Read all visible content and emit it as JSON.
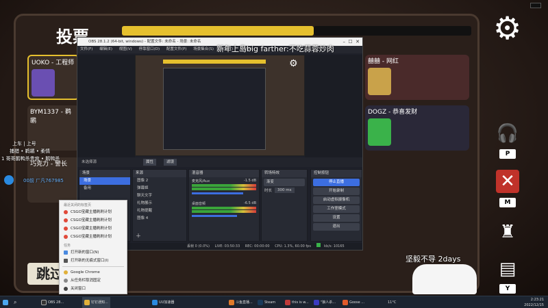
{
  "game": {
    "vote_title": "投票",
    "skip_label": "跳过",
    "players": [
      {
        "name": "UOKO - 工程师"
      },
      {
        "name": "BYM1337 - 鹈鹕"
      },
      {
        "name": "巧克力 - 警长"
      },
      {
        "name": "囍囍 - 网红"
      },
      {
        "name": "DOGZ - 恭喜发财"
      }
    ],
    "side_keys": [
      "P",
      "M",
      "Y"
    ],
    "left_messages": [
      "上车 | 上号",
      "捕猎 • 鹈鹕 • 柔情",
      "1 哥哥鹅鸭杀贵宾 • 鹅鸭杀",
      "00前 ㄏ凡767985"
    ],
    "streamer_tag": "坚毅不导 2days"
  },
  "chat_overlay": {
    "title": "新年上岛big farther:不吃蒜蓉炒肉"
  },
  "obs": {
    "window_title": "OBS 28.1.2 (64-bit, windows) - 配置文件: 未命名 - 场景: 未命名",
    "menu": [
      "文件(F)",
      "编辑(E)",
      "视图(V)",
      "停靠窗口(D)",
      "配置文件(P)",
      "场景集合(S)",
      "工具(T)",
      "帮助(H)"
    ],
    "source_bar": {
      "label": "未选择源",
      "props": "属性",
      "filters": "滤镜"
    },
    "scenes": {
      "title": "场景",
      "items": [
        "场景",
        "备用"
      ]
    },
    "sources": {
      "title": "来源",
      "items": [
        "图像 2",
        "弹幕姬",
        "聊天文字",
        "礼物展示",
        "礼物提醒",
        "图像 4"
      ]
    },
    "mixer": {
      "title": "混音器",
      "channels": [
        {
          "name": "麦克风/Aux",
          "db": "-1.5 dB"
        },
        {
          "name": "桌面音频",
          "db": "-6.5 dB"
        }
      ]
    },
    "transitions": {
      "title": "转场特效",
      "type": "渐变",
      "duration_label": "时长",
      "duration": "300 ms"
    },
    "controls": {
      "title": "控制按钮",
      "buttons": [
        "停止直播",
        "开始录制",
        "启动虚拟摄像机",
        "工作室模式",
        "设置",
        "退出"
      ]
    },
    "status": {
      "dropped": "丢帧 0 (0.0%)",
      "live": "LIVE: 03:50:33",
      "rec": "REC: 00:00:00",
      "cpu": "CPU: 1.3%, 60.00 fps",
      "bitrate": "kb/s: 10165"
    }
  },
  "context_menu": {
    "recent_heading": "最近关闭的标签页",
    "recent": [
      "CSGO宝藏主播刷刷计划",
      "CSGO宝藏主播刷刷计划",
      "CSGO宝藏主播刷刷计划",
      "CSGO宝藏主播刷刷计划"
    ],
    "task_heading": "任务",
    "tasks": [
      "打开新的窗口(N)",
      "打开新的无痕式窗口(I)"
    ],
    "app": "Google Chrome",
    "unpin": "从任务栏取消固定",
    "close": "关闭窗口"
  },
  "taskbar": {
    "items": [
      "OBS 28...",
      "钉钉通知...",
      "UU加速器",
      "斗鱼直播...",
      "Steam",
      "this is w...",
      "\"狼人杀...",
      "Goose ..."
    ],
    "weather": "11°C",
    "time": "2:23:21",
    "date": "2022/12/15"
  },
  "colors": {
    "accent": "#3c6ee0",
    "obs_bg": "#1e2029",
    "yellow_bar": "#e6c02e"
  }
}
